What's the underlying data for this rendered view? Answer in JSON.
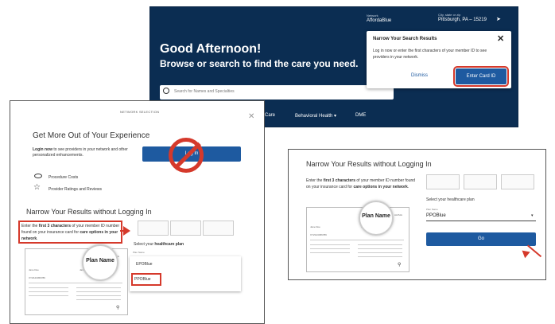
{
  "top": {
    "greeting": "Good Afternoon!",
    "subtitle": "Browse or search to find the care you need.",
    "search_placeholder": "Search for Names and Specialties",
    "network_label": "Network",
    "network_value": "AffordaBlue",
    "location_label": "City, state or zip",
    "location_value": "Pittsburgh, PA – 15219",
    "menu": [
      "ent Care",
      "Behavioral Health ▾",
      "DME"
    ],
    "popup": {
      "title": "Narrow Your Search Results",
      "body": "Log in now or enter the first characters of your member ID to see providers in your network.",
      "dismiss": "Dismiss",
      "enter_card": "Enter Card ID"
    }
  },
  "left": {
    "header": "NETWORK SELECTION",
    "title": "Get More Out of Your Experience",
    "desc_bold": "Login now",
    "desc_rest": " to see providers in your network and other personalized enhancements.",
    "login_button": "Log In",
    "features": [
      "Procedure Costs",
      "Provider Ratings and Reviews"
    ],
    "narrow_title": "Narrow Your Results without Logging In",
    "instr": {
      "p1": "Enter the ",
      "b1": "first 3 characters",
      "p2": " of your member ID number found on your insurance card for ",
      "b2": "care options in your network",
      "p3": "."
    },
    "select_plan_prefix": "Select your ",
    "select_plan_bold": "healthcare plan",
    "plan_label": "Plan Name",
    "options": [
      "EPOBlue",
      "PPOBlue"
    ]
  },
  "card": {
    "plan_name": "Plan Name",
    "alpha": "ALPHA",
    "member_name": "Jane Doe",
    "member_id": "XYZ123456789"
  },
  "right": {
    "title": "Narrow Your Results without Logging In",
    "instr": {
      "p1": "Enter the ",
      "b1": "first 3 characters",
      "p2": " of your member ID number found on your insurance card for ",
      "b2": "care options in your network",
      "p3": "."
    },
    "select_plan": "Select your healthcare plan",
    "plan_label": "Plan Name",
    "plan_value": "PPOBlue",
    "go": "Go"
  },
  "colors": {
    "navy": "#0b2d52",
    "accent_blue": "#1e5aa0",
    "highlight_red": "#d5392b"
  }
}
